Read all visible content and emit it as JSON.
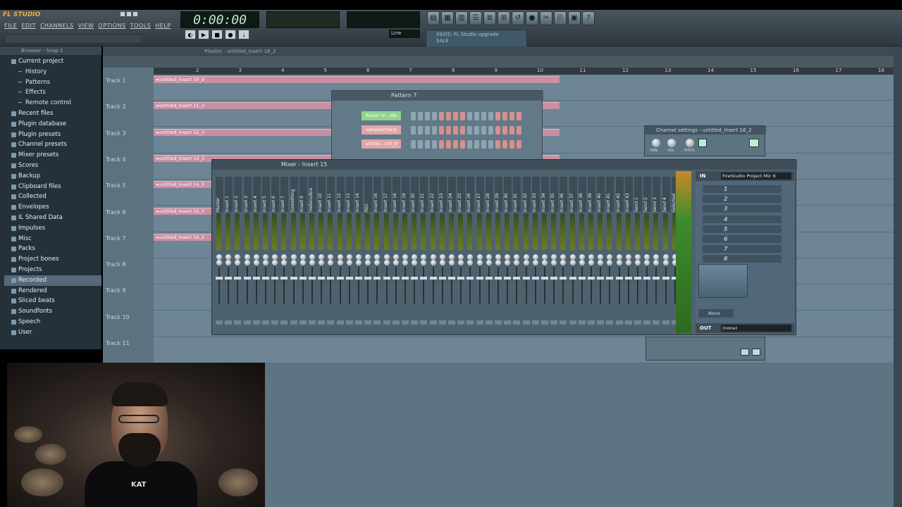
{
  "app": {
    "logo": "FL STUDIO",
    "menu": [
      "FILE",
      "EDIT",
      "CHANNELS",
      "VIEW",
      "OPTIONS",
      "TOOLS",
      "HELP"
    ]
  },
  "transport": {
    "time": "0:00:00",
    "snap": "Line",
    "news_line1": "09/05: FL Studio upgrade",
    "news_line2": "SALE"
  },
  "browser": {
    "title": "Browser - Snap 1",
    "items": [
      {
        "label": "Current project",
        "sub": false
      },
      {
        "label": "History",
        "sub": true
      },
      {
        "label": "Patterns",
        "sub": true
      },
      {
        "label": "Effects",
        "sub": true
      },
      {
        "label": "Remote control",
        "sub": true
      },
      {
        "label": "Recent files",
        "sub": false
      },
      {
        "label": "Plugin database",
        "sub": false
      },
      {
        "label": "Plugin presets",
        "sub": false
      },
      {
        "label": "Channel presets",
        "sub": false
      },
      {
        "label": "Mixer presets",
        "sub": false
      },
      {
        "label": "Scores",
        "sub": false
      },
      {
        "label": "Backup",
        "sub": false
      },
      {
        "label": "Clipboard files",
        "sub": false
      },
      {
        "label": "Collected",
        "sub": false
      },
      {
        "label": "Envelopes",
        "sub": false
      },
      {
        "label": "IL Shared Data",
        "sub": false
      },
      {
        "label": "Impulses",
        "sub": false
      },
      {
        "label": "Misc",
        "sub": false
      },
      {
        "label": "Packs",
        "sub": false
      },
      {
        "label": "Project bones",
        "sub": false
      },
      {
        "label": "Projects",
        "sub": false
      },
      {
        "label": "Recorded",
        "sub": false,
        "selected": true
      },
      {
        "label": "Rendered",
        "sub": false
      },
      {
        "label": "Sliced beats",
        "sub": false
      },
      {
        "label": "Soundfonts",
        "sub": false
      },
      {
        "label": "Speech",
        "sub": false
      },
      {
        "label": "User",
        "sub": false
      }
    ]
  },
  "playlist": {
    "title": "Playlist - untitled_Insert 16_2",
    "ruler": [
      "2",
      "3",
      "4",
      "5",
      "6",
      "7",
      "8",
      "9",
      "10",
      "11",
      "12",
      "13",
      "14",
      "15",
      "16",
      "17",
      "18"
    ],
    "tracks": [
      "Track 1",
      "Track 2",
      "Track 3",
      "Track 4",
      "Track 5",
      "Track 6",
      "Track 7",
      "Track 8",
      "Track 9",
      "Track 10",
      "Track 11"
    ],
    "clips": [
      "untitled_Insert 10_9",
      "untitled_Insert 11_3",
      "untitled_Insert 12_3",
      "untitled_Insert 13_3",
      "untitled_Insert 14_3",
      "untitled_Insert 15_3",
      "untitled_Insert 16_2"
    ]
  },
  "pattern": {
    "title": "Pattern 7",
    "channels": [
      "Kaiser le...dip",
      "samplechang",
      "untitle...r10_9"
    ]
  },
  "channel_settings": {
    "title": "Channel settings - untitled_Insert 16_2",
    "knobs": [
      "PAN",
      "VOL",
      "PITCH"
    ]
  },
  "mixer": {
    "title": "Mixer - Insert 15",
    "strips": [
      "Master",
      "Insert 1",
      "Insert 2",
      "Insert 3",
      "Insert 4",
      "Insert 5",
      "Insert 6",
      "Insert 7",
      "Something",
      "Insert 9",
      "Hellerudino",
      "Insert 10",
      "Insert 11",
      "Insert 12",
      "Insert 13",
      "Insert 14",
      "REC",
      "Insert 16",
      "Insert 17",
      "Insert 18",
      "Insert 19",
      "Insert 20",
      "Insert 21",
      "Insert 22",
      "Insert 23",
      "Insert 24",
      "Insert 25",
      "Insert 26",
      "Insert 27",
      "Insert 28",
      "Insert 29",
      "Insert 30",
      "Insert 31",
      "Insert 32",
      "Insert 33",
      "Insert 34",
      "Insert 35",
      "Insert 36",
      "Insert 37",
      "Insert 38",
      "Insert 39",
      "Insert 40",
      "Insert 41",
      "Insert 42",
      "Insert 43",
      "Send 1",
      "Send 2",
      "Send 3",
      "Send 4",
      "Selected"
    ],
    "in_label": "IN",
    "in_value": "FireStudio Project Mic 6",
    "fx_slots": [
      "1",
      "2",
      "3",
      "4",
      "5",
      "6",
      "7",
      "8"
    ],
    "eq_preset": "None",
    "out_label": "OUT",
    "out_value": "(none)"
  },
  "webcam": {
    "shirt_text": "KAT"
  },
  "colors": {
    "clip": "#c98fa3",
    "step_on": "#d98f8f",
    "step_off": "#8fa6b2",
    "channel_green": "#8ed48c",
    "channel_pink": "#e3a3a9",
    "accent": "#e0a23c"
  }
}
